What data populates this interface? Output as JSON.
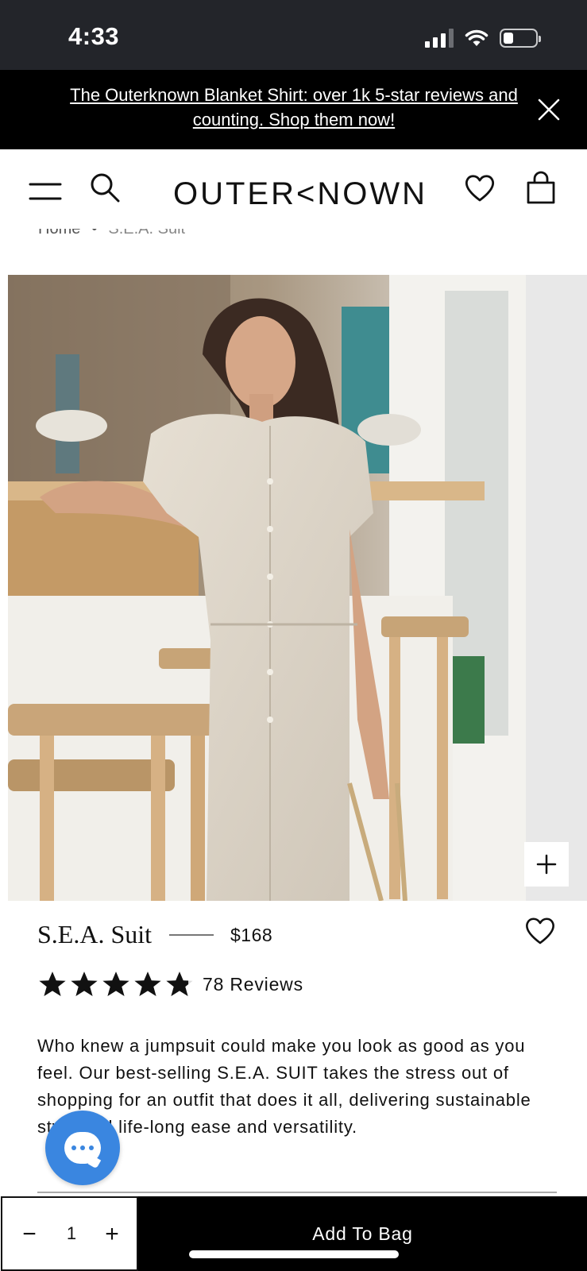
{
  "status_bar": {
    "time": "4:33"
  },
  "announcement": {
    "text": "The Outerknown Blanket Shirt: over 1k 5-star reviews and counting. Shop them now!"
  },
  "header": {
    "logo": "OUTER<NOWN",
    "icons": [
      "menu-icon",
      "search-icon",
      "heart-icon",
      "bag-icon"
    ]
  },
  "breadcrumb": {
    "home": "Home",
    "separator": "•",
    "current": "S.E.A. Suit"
  },
  "product": {
    "name": "S.E.A. Suit",
    "price": "$168",
    "rating": 4.8,
    "review_count": "78 Reviews",
    "description": "Who knew a jumpsuit could make you look as good as you feel. Our best-selling S.E.A. SUIT takes the stress out of shopping for an outfit that does it all, delivering sustainable style and life-long ease and versatility."
  },
  "cart": {
    "quantity": "1",
    "minus_label": "−",
    "plus_label": "+",
    "add_label": "Add To Bag"
  },
  "colors": {
    "status_bar_bg": "#23252a",
    "announcement_bg": "#000000",
    "chat_blue": "#3a86e0",
    "button_black": "#000000"
  }
}
